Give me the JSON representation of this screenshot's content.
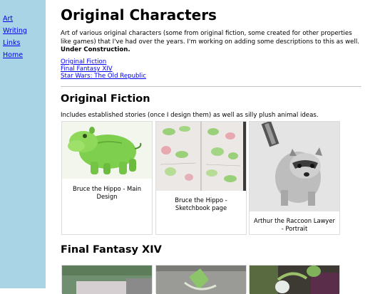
{
  "sidebar": {
    "links": [
      "Art",
      "Writing",
      "Links",
      "Home"
    ]
  },
  "page": {
    "title": "Original Characters",
    "intro": "Art of various original characters (some from original fiction, some created for other properties like games) that I've had over the years. I'm working on adding some descriptions to this as well.",
    "intro_bold": "Under Construction.",
    "toc": [
      "Original Fiction",
      "Final Fantasy XIV",
      "Star Wars: The Old Republic"
    ]
  },
  "sections": {
    "original_fiction": {
      "heading": "Original Fiction",
      "description": "Includes established stories (once I design them) as well as silly plush animal ideas.",
      "cards": [
        {
          "caption": "Bruce the Hippo - Main Design",
          "image": "green-hippo-drawing"
        },
        {
          "caption": "Bruce the Hippo - Sketchbook page",
          "image": "hippo-sketchbook-page"
        },
        {
          "caption": "Arthur the Raccoon Lawyer - Portrait",
          "image": "raccoon-pencil-drawing"
        }
      ]
    },
    "ffxiv": {
      "heading": "Final Fantasy XIV"
    }
  },
  "colors": {
    "sidebar_bg": "#a8d4e6",
    "link": "#0000ee"
  }
}
